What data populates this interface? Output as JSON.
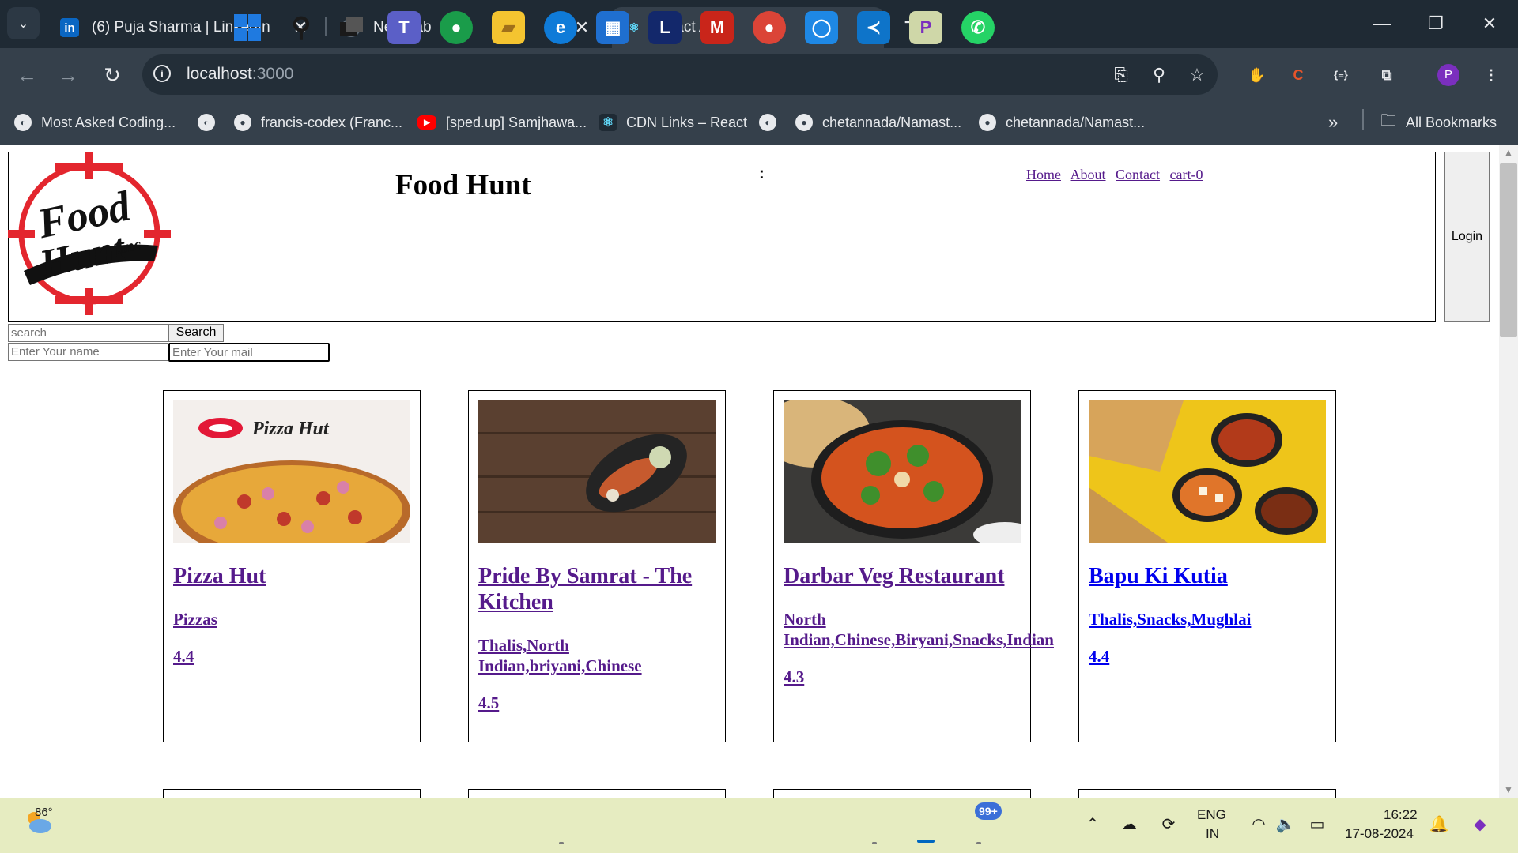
{
  "browser": {
    "tabs": [
      {
        "title": "(6) Puja Sharma | LinkedIn",
        "icon": "linkedin-icon",
        "close": "✕"
      },
      {
        "title": "New Tab",
        "icon": "chrome-icon",
        "close": "✕"
      },
      {
        "title": "React App",
        "icon": "react-icon",
        "close": "✕",
        "active": true
      }
    ],
    "new_tab": "+",
    "url_host": "localhost",
    "url_port": ":3000",
    "bookmarks": [
      {
        "label": "Most Asked Coding...",
        "icon": "globe-icon"
      },
      {
        "label": "",
        "icon": "globe-icon"
      },
      {
        "label": "francis-codex (Franc...",
        "icon": "github-icon"
      },
      {
        "label": "[sped.up] Samjhawa...",
        "icon": "youtube-icon"
      },
      {
        "label": "CDN Links – React",
        "icon": "react-icon"
      },
      {
        "label": "",
        "icon": "globe-icon"
      },
      {
        "label": "chetannada/Namast...",
        "icon": "github-icon"
      },
      {
        "label": "chetannada/Namast...",
        "icon": "github-icon"
      }
    ],
    "bookmarks_overflow": "»",
    "all_bookmarks": "All Bookmarks",
    "profile_initial": "P"
  },
  "site": {
    "title": "Food Hunt",
    "colon": ":",
    "logo_text": [
      "Food",
      "Hunt",
      ".inc"
    ],
    "nav": [
      "Home",
      "About",
      "Contact",
      "cart-0"
    ],
    "login_label": "Login",
    "search_placeholder": "search",
    "search_button": "Search",
    "name_placeholder": "Enter Your name",
    "mail_placeholder": "Enter Your mail"
  },
  "restaurants": [
    {
      "name": "Pizza Hut",
      "cuisines": "Pizzas",
      "rating": "4.4",
      "image": "pizza-image",
      "logo_text": "Pizza Hut"
    },
    {
      "name": "Pride By Samrat - The Kitchen",
      "cuisines": "Thalis,North Indian,briyani,Chinese",
      "rating": "4.5",
      "image": "kebab-image"
    },
    {
      "name": "Darbar Veg Restaurant",
      "cuisines": "North Indian,Chinese,Biryani,Snacks,Indian",
      "rating": "4.3",
      "image": "curry-image"
    },
    {
      "name": "Bapu Ki Kutia",
      "cuisines": "Thalis,Snacks,Mughlai",
      "rating": "4.4",
      "image": "thali-image"
    }
  ],
  "taskbar": {
    "weather_temp": "86°",
    "notification_badge": "99+",
    "language": "ENG",
    "region": "IN",
    "time": "16:22",
    "date": "17-08-2024",
    "colors": {
      "accent": "#0067c0",
      "background": "#e6ecc1"
    }
  },
  "colors": {
    "visited_link": "#551a8b",
    "link": "#0000ee",
    "chrome_dark": "#1f2a34",
    "chrome_toolbar": "#35404b"
  }
}
